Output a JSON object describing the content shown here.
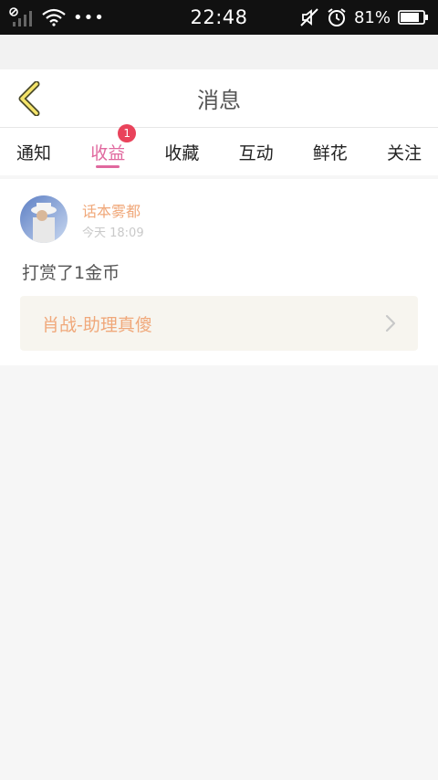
{
  "status_bar": {
    "time": "22:48",
    "battery": "81%",
    "icons": [
      "signal-icon",
      "wifi-icon",
      "more-icon",
      "mute-icon",
      "alarm-icon",
      "battery-icon"
    ]
  },
  "header": {
    "title": "消息",
    "back_icon": "back-chevron-icon"
  },
  "tabs": [
    {
      "label": "通知"
    },
    {
      "label": "收益",
      "active": true,
      "badge": "1"
    },
    {
      "label": "收藏"
    },
    {
      "label": "互动"
    },
    {
      "label": "鲜花"
    },
    {
      "label": "关注"
    }
  ],
  "message": {
    "username": "话本雾都",
    "time": "今天 18:09",
    "text": "打赏了1金币",
    "link_text": "肖战-助理真傻",
    "link_icon": "chevron-right-icon"
  },
  "colors": {
    "accent": "#e0689e",
    "badge": "#e9435b",
    "name": "#f0a87a"
  }
}
